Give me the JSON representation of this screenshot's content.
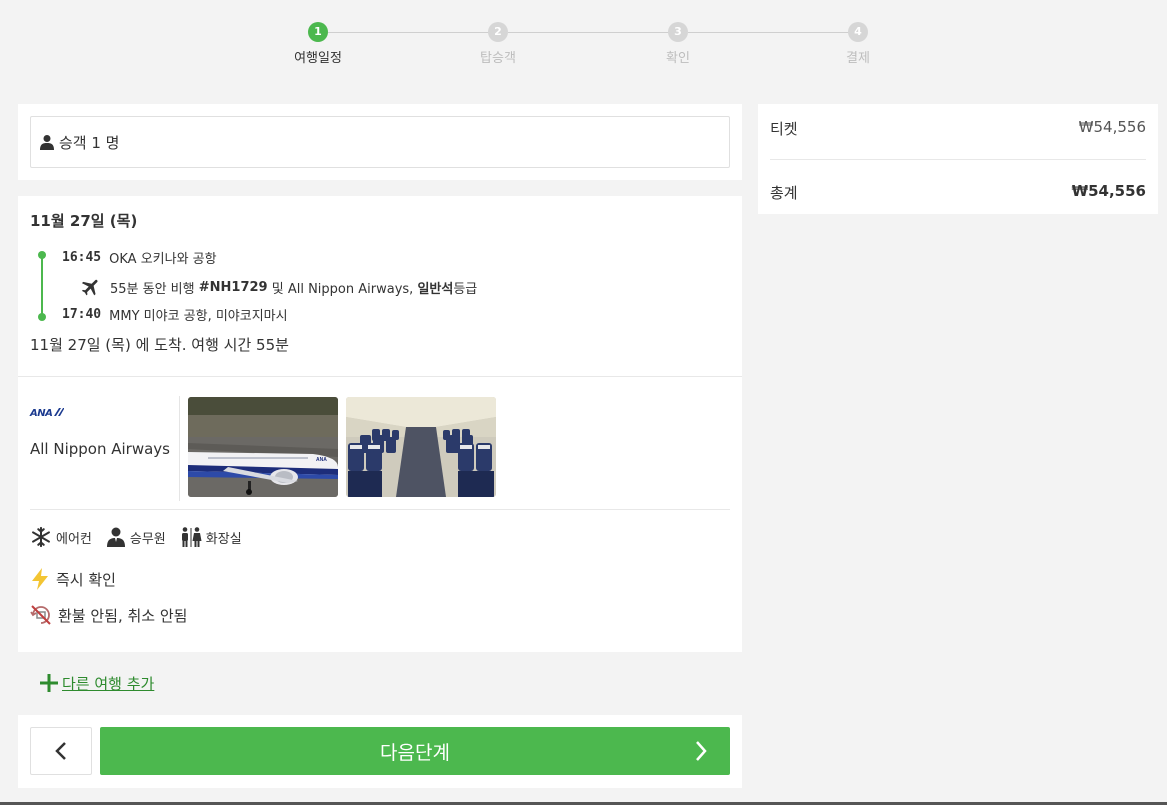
{
  "stepper": {
    "steps": [
      {
        "num": "1",
        "label": "여행일정"
      },
      {
        "num": "2",
        "label": "탑승객"
      },
      {
        "num": "3",
        "label": "확인"
      },
      {
        "num": "4",
        "label": "결제"
      }
    ]
  },
  "passengers": {
    "label": "승객 1 명"
  },
  "itinerary": {
    "date": "11월 27일 (목)",
    "departure": {
      "time": "16:45",
      "place": "OKA 오키나와 공항"
    },
    "flight": {
      "prefix": "55분 동안 비행",
      "number": "#NH1729",
      "mid": "및 All Nippon Airways,",
      "cabin": "일반석",
      "suffix": "등급"
    },
    "arrival": {
      "time": "17:40",
      "place": "MMY 미야코 공항, 미야코지마시"
    },
    "arrival_note": "11월 27일 (목) 에 도착. 여행 시간 55분"
  },
  "airline": {
    "logo_text": "ANA",
    "name": "All Nippon Airways"
  },
  "amenities": [
    {
      "icon": "snowflake-icon",
      "label": "에어컨"
    },
    {
      "icon": "attendant-icon",
      "label": "승무원"
    },
    {
      "icon": "restroom-icon",
      "label": "화장실"
    }
  ],
  "policies": {
    "instant": "즉시 확인",
    "refund": "환불 안됨, 취소 안됨"
  },
  "add_trip": {
    "label": "다른 여행 추가"
  },
  "nav": {
    "next_label": "다음단계"
  },
  "summary": {
    "ticket_label": "티켓",
    "ticket_amount": "₩54,556",
    "total_label": "총계",
    "total_amount": "₩54,556"
  },
  "colors": {
    "accent": "#4cb84e",
    "link": "#2e8b2e"
  }
}
